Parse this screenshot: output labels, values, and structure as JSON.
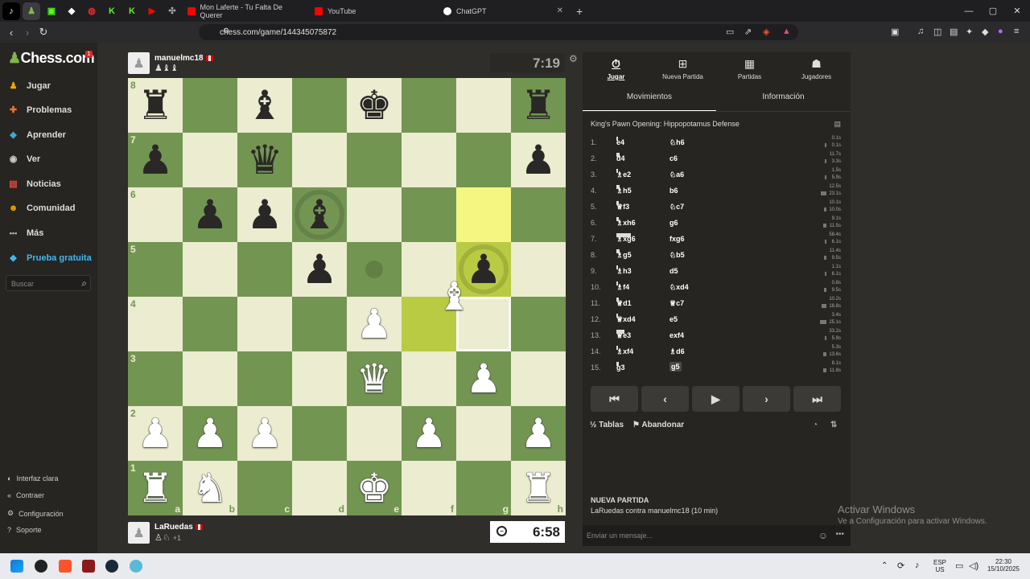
{
  "browser": {
    "tabs": [
      {
        "title": "Mon Laferte - Tu Falta De Querer",
        "color": "#e91e63"
      },
      {
        "title": "YouTube",
        "color": "#ff0000"
      },
      {
        "title": "ChatGPT",
        "color": "#ffffff"
      }
    ],
    "url": "chess.com/game/144345075872",
    "new_tab": "+",
    "win_minimize": "—",
    "win_maximize": "▢",
    "win_close": "✕"
  },
  "sidebar": {
    "logo": "Chess.com",
    "notification_count": "1",
    "items": [
      {
        "label": "Jugar",
        "color": "#f7a400",
        "glyph": "♟"
      },
      {
        "label": "Problemas",
        "color": "#f2732d",
        "glyph": "✚"
      },
      {
        "label": "Aprender",
        "color": "#3fa7d6",
        "glyph": "◆"
      },
      {
        "label": "Ver",
        "color": "#ccc",
        "glyph": "◉"
      },
      {
        "label": "Noticias",
        "color": "#e64a3d",
        "glyph": "▤"
      },
      {
        "label": "Comunidad",
        "color": "#f0a500",
        "glyph": "☻"
      },
      {
        "label": "Más",
        "color": "#bbb",
        "glyph": "•••"
      }
    ],
    "trial": "Prueba gratuita",
    "search_placeholder": "Buscar",
    "footer": [
      {
        "label": "Interfaz clara",
        "glyph": "◐"
      },
      {
        "label": "Contraer",
        "glyph": "«"
      },
      {
        "label": "Configuración",
        "glyph": "⚙"
      },
      {
        "label": "Soporte",
        "glyph": "?"
      }
    ]
  },
  "top_player": {
    "name": "manuelmc18",
    "captured": "♟♝♝",
    "clock": "7:19"
  },
  "bottom_player": {
    "name": "LaRuedas",
    "captured": "♙♘",
    "extra": "+1",
    "clock": "6:58"
  },
  "board": {
    "ranks": [
      "8",
      "7",
      "6",
      "5",
      "4",
      "3",
      "2",
      "1"
    ],
    "files": [
      "a",
      "b",
      "c",
      "d",
      "e",
      "f",
      "g",
      "h"
    ],
    "position": [
      [
        "r",
        "",
        "b",
        "",
        "k",
        "",
        "",
        "r"
      ],
      [
        "p",
        "",
        "q",
        "",
        "",
        "",
        "",
        "p"
      ],
      [
        "",
        "p",
        "p",
        "b",
        "",
        "",
        "",
        ""
      ],
      [
        "",
        "",
        "",
        "p",
        "",
        "",
        "p",
        ""
      ],
      [
        "",
        "",
        "",
        "",
        "P",
        "",
        "",
        ""
      ],
      [
        "",
        "",
        "",
        "",
        "Q",
        "",
        "P",
        ""
      ],
      [
        "P",
        "P",
        "P",
        "",
        "",
        "P",
        "",
        "P"
      ],
      [
        "R",
        "N",
        "",
        "",
        "K",
        "",
        "",
        "R"
      ]
    ],
    "highlights": [
      [
        2,
        6
      ],
      [
        3,
        6
      ]
    ],
    "move_hint_square": [
      4,
      5
    ],
    "capture_rings": [
      [
        2,
        3
      ],
      [
        3,
        6
      ]
    ],
    "dots": [
      [
        3,
        4
      ]
    ],
    "dragged_piece": {
      "glyph": "B",
      "square": [
        4,
        6
      ]
    }
  },
  "panel": {
    "tabs": [
      {
        "label": "Jugar",
        "glyph": "⏱"
      },
      {
        "label": "Nueva Partida",
        "glyph": "⊞"
      },
      {
        "label": "Partidas",
        "glyph": "▦"
      },
      {
        "label": "Jugadores",
        "glyph": "☗"
      }
    ],
    "subtabs": [
      "Movimientos",
      "Información"
    ],
    "opening": "King's Pawn Opening: Hippopotamus Defense",
    "moves": [
      {
        "n": "1.",
        "w": "e4",
        "b": "♘h6",
        "tw": "0.1s",
        "tb": "0.1s",
        "bw": 0.02,
        "bb": 0.02
      },
      {
        "n": "2.",
        "w": "d4",
        "b": "c6",
        "tw": "11.7s",
        "tb": "3.3s",
        "bw": 0.2,
        "bb": 0.06
      },
      {
        "n": "3.",
        "w": "♗e2",
        "b": "♘a6",
        "tw": "1.5s",
        "tb": "5.9s",
        "bw": 0.03,
        "bb": 0.1
      },
      {
        "n": "4.",
        "w": "♗h5",
        "b": "b6",
        "tw": "12.5s",
        "tb": "23.1s",
        "bw": 0.21,
        "bb": 0.4
      },
      {
        "n": "5.",
        "w": "♕f3",
        "b": "♘c7",
        "tw": "10.1s",
        "tb": "10.0s",
        "bw": 0.17,
        "bb": 0.17
      },
      {
        "n": "6.",
        "w": "♗xh6",
        "b": "g6",
        "tw": "9.1s",
        "tb": "11.5s",
        "bw": 0.16,
        "bb": 0.2
      },
      {
        "n": "7.",
        "w": "♗xg6",
        "b": "fxg6",
        "tw": "58.4s",
        "tb": "6.1s",
        "bw": 1.0,
        "bb": 0.1
      },
      {
        "n": "8.",
        "w": "♗g5",
        "b": "♘b5",
        "tw": "11.4s",
        "tb": "9.5s",
        "bw": 0.2,
        "bb": 0.16
      },
      {
        "n": "9.",
        "w": "♗h3",
        "b": "d5",
        "tw": "1.1s",
        "tb": "6.1s",
        "bw": 0.02,
        "bb": 0.1
      },
      {
        "n": "10.",
        "w": "♗f4",
        "b": "♘xd4",
        "tw": "0.8s",
        "tb": "9.5s",
        "bw": 0.02,
        "bb": 0.16
      },
      {
        "n": "11.",
        "w": "♕d1",
        "b": "♕c7",
        "tw": "10.2s",
        "tb": "18.8s",
        "bw": 0.17,
        "bb": 0.32
      },
      {
        "n": "12.",
        "w": "♕xd4",
        "b": "e5",
        "tw": "3.4s",
        "tb": "25.1s",
        "bw": 0.06,
        "bb": 0.43
      },
      {
        "n": "13.",
        "w": "♕e3",
        "b": "exf4",
        "tw": "33.2s",
        "tb": "5.9s",
        "bw": 0.57,
        "bb": 0.1
      },
      {
        "n": "14.",
        "w": "♗xf4",
        "b": "♗d6",
        "tw": "5.3s",
        "tb": "13.6s",
        "bw": 0.09,
        "bb": 0.23
      },
      {
        "n": "15.",
        "w": "g3",
        "b": "g5",
        "tw": "8.1s",
        "tb": "11.8s",
        "bw": 0.14,
        "bb": 0.2
      }
    ],
    "nav": [
      "⏮",
      "‹",
      "▶",
      "›",
      "⏭"
    ],
    "draw": "Tablas",
    "draw_glyph": "½",
    "resign": "Abandonar",
    "resign_glyph": "⚑",
    "new_game_title": "NUEVA PARTIDA",
    "new_game_desc": "LaRuedas contra manuelmc18 (10 min)",
    "message_placeholder": "Enviar un mensaje..."
  },
  "watermark": {
    "line1": "Activar Windows",
    "line2": "Ve a Configuración para activar Windows."
  },
  "taskbar": {
    "lang1": "ESP",
    "lang2": "US",
    "time": "22:30",
    "date": "15/10/2025"
  }
}
